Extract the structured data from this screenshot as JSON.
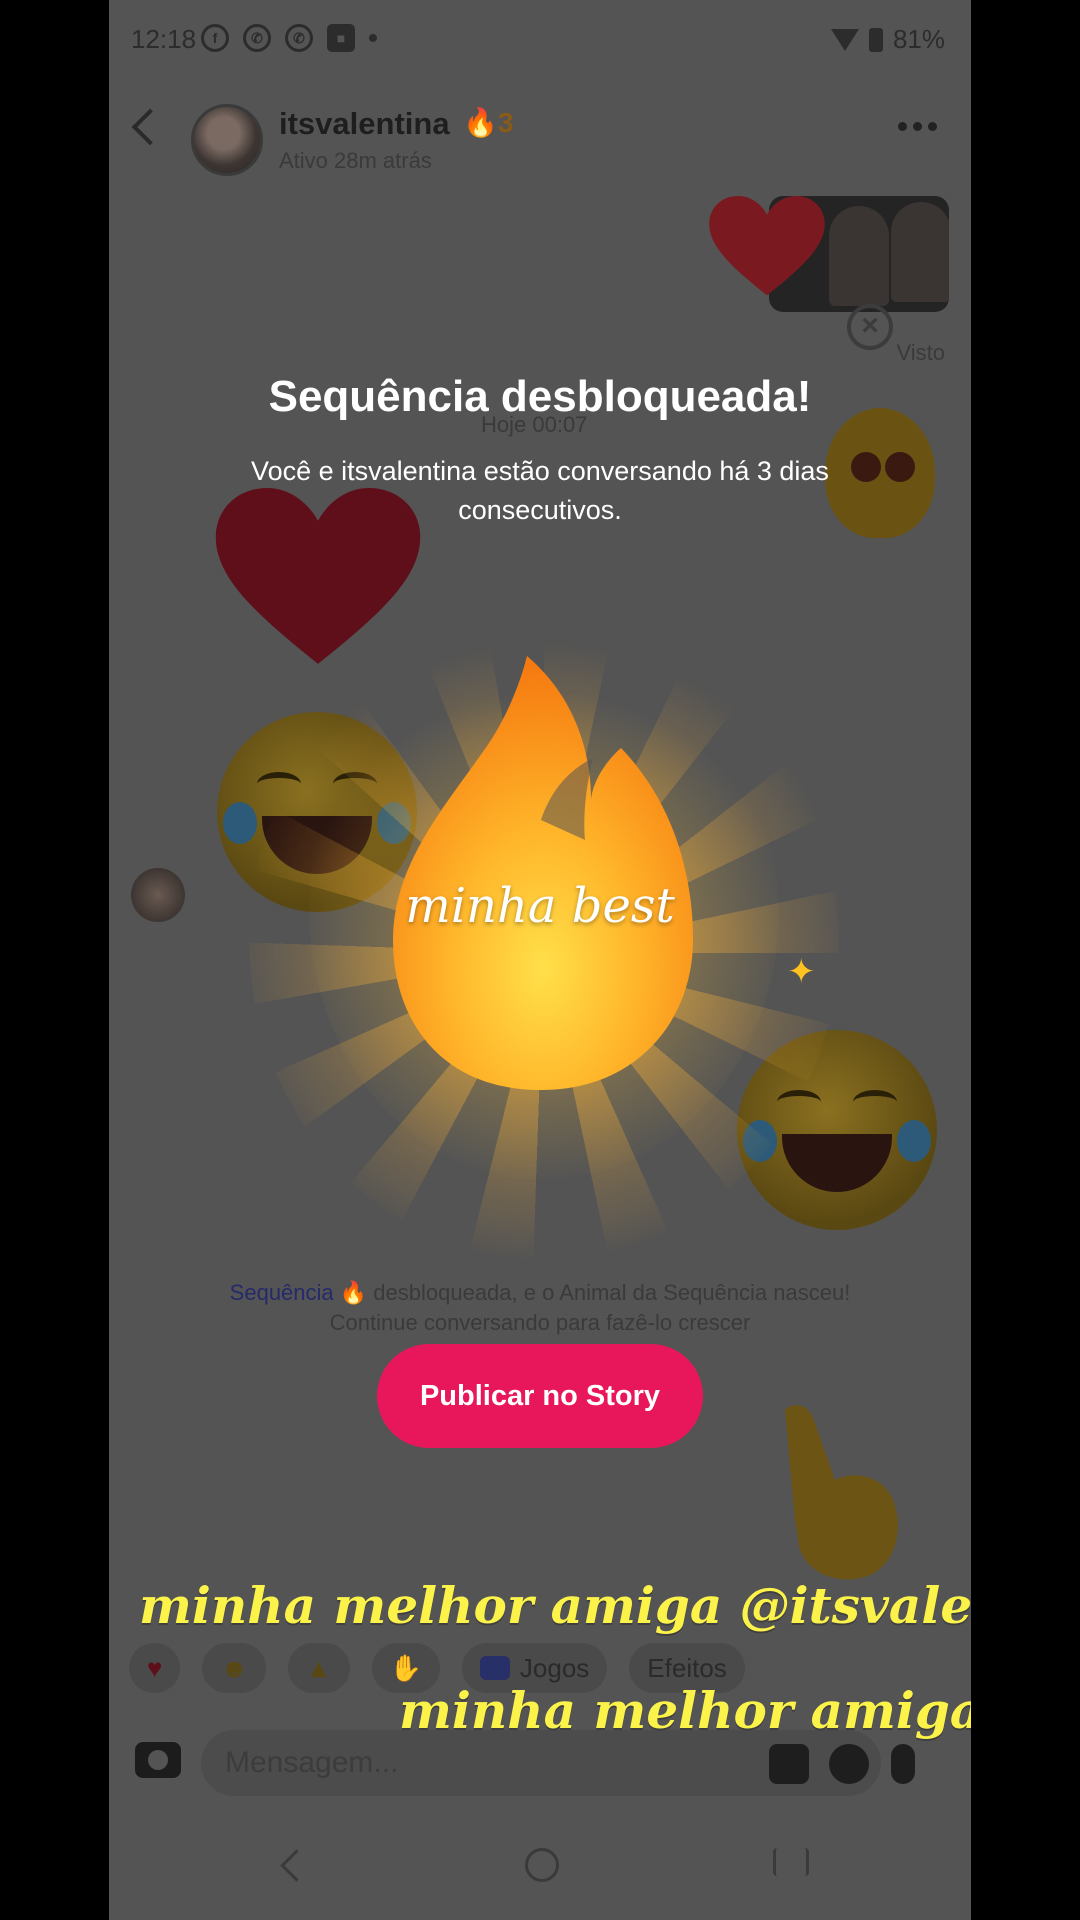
{
  "status_bar": {
    "time": "12:18",
    "battery": "81%",
    "app_icons": [
      "facebook-icon",
      "whatsapp-icon",
      "whatsapp-icon",
      "roblox-icon"
    ]
  },
  "chat": {
    "contact_name": "itsvalentina",
    "streak_count": "3",
    "active_status": "Ativo 28m atrás",
    "seen_label": "Visto",
    "date_divider": "Hoje 00:07",
    "streak_note_highlight": "Sequência",
    "streak_note_rest": " desbloqueada, e o Animal da Sequência nasceu!",
    "streak_note_line2": "Continue conversando para fazê-lo crescer"
  },
  "modal": {
    "title": "Sequência desbloqueada!",
    "subtitle": "Você e itsvalentina estão conversando há 3 dias consecutivos.",
    "flame_caption": "minha best",
    "publish_button": "Publicar no Story"
  },
  "quick_replies": {
    "games_label": "Jogos",
    "effects_label": "Efeitos"
  },
  "composer": {
    "placeholder": "Mensagem..."
  },
  "story_text": {
    "line1": "minha melhor amiga @itsvalentina",
    "line2": "minha melhor amiga"
  },
  "colors": {
    "accent_pink": "#e8165a",
    "story_text_yellow": "#fbf24a",
    "flame_orange": "#ff9c1a",
    "heart_red": "#e0202e"
  }
}
